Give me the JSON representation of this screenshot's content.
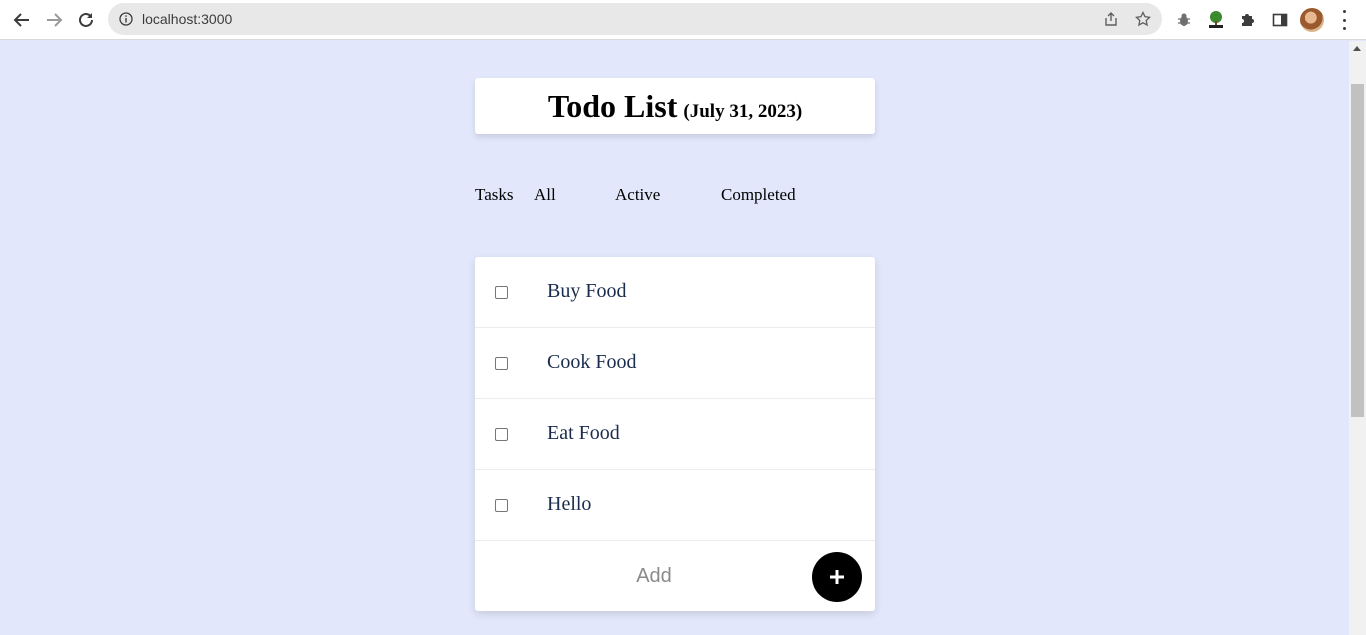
{
  "browser": {
    "url": "localhost:3000",
    "icons": {
      "back": "arrow-left-icon",
      "forward": "arrow-right-icon",
      "reload": "reload-icon",
      "info": "info-icon",
      "share": "share-icon",
      "bookmark": "star-icon",
      "extension1": "bug-extension-icon",
      "extension2": "tree-extension-icon",
      "extensions": "puzzle-icon",
      "sidepanel": "side-panel-icon",
      "profile": "avatar",
      "menu": "kebab-menu-icon"
    }
  },
  "app": {
    "title": "Todo List",
    "date": "(July 31, 2023)",
    "filters": {
      "label": "Tasks",
      "all": "All",
      "active": "Active",
      "completed": "Completed"
    },
    "todos": [
      {
        "text": "Buy Food",
        "done": false
      },
      {
        "text": "Cook Food",
        "done": false
      },
      {
        "text": "Eat Food",
        "done": false
      },
      {
        "text": "Hello",
        "done": false
      }
    ],
    "add_placeholder": "Add",
    "add_button_icon": "plus-icon"
  },
  "colors": {
    "background": "#e2e7fb",
    "card": "#ffffff",
    "todo_text": "#1a2b4d",
    "add_button": "#000000"
  }
}
